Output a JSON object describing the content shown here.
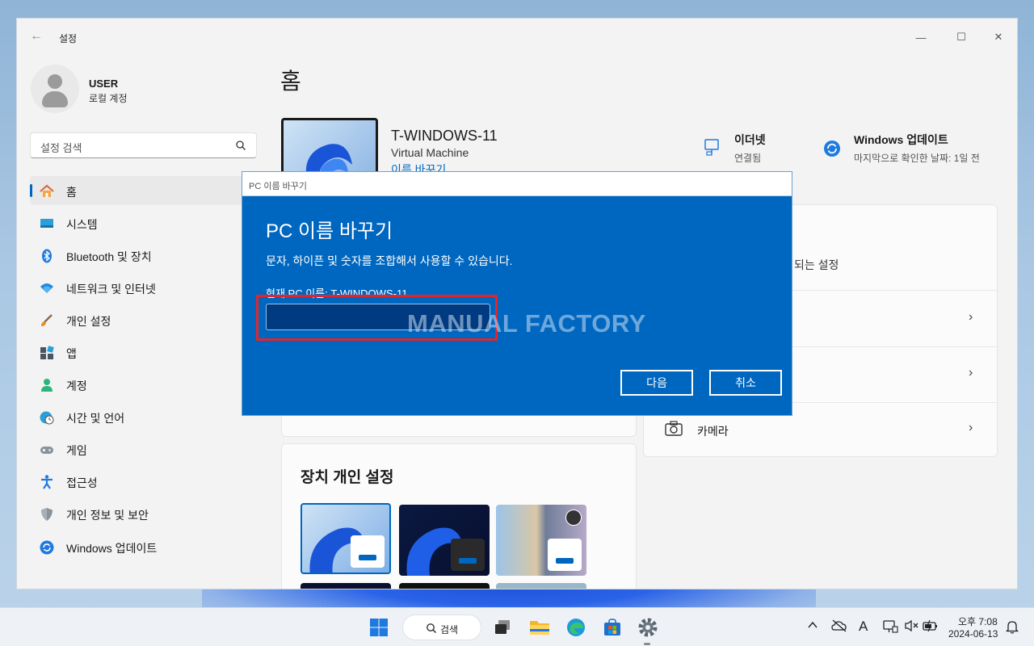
{
  "app": {
    "title": "설정"
  },
  "window_controls": {
    "minimize": "—",
    "maximize": "☐",
    "close": "✕"
  },
  "profile": {
    "name": "USER",
    "account_type": "로컬 계정"
  },
  "search": {
    "placeholder": "설정 검색"
  },
  "nav": [
    {
      "label": "홈",
      "icon": "home-icon",
      "active": true
    },
    {
      "label": "시스템",
      "icon": "system-icon"
    },
    {
      "label": "Bluetooth 및 장치",
      "icon": "bluetooth-icon"
    },
    {
      "label": "네트워크 및 인터넷",
      "icon": "wifi-icon"
    },
    {
      "label": "개인 설정",
      "icon": "brush-icon"
    },
    {
      "label": "앱",
      "icon": "apps-icon"
    },
    {
      "label": "계정",
      "icon": "account-icon"
    },
    {
      "label": "시간 및 언어",
      "icon": "globe-clock-icon"
    },
    {
      "label": "게임",
      "icon": "gamepad-icon"
    },
    {
      "label": "접근성",
      "icon": "accessibility-icon"
    },
    {
      "label": "개인 정보 및 보안",
      "icon": "shield-icon"
    },
    {
      "label": "Windows 업데이트",
      "icon": "update-icon"
    }
  ],
  "main": {
    "title": "홈",
    "device": {
      "name": "T-WINDOWS-11",
      "type": "Virtual Machine",
      "rename_link": "이름 바꾸기"
    },
    "status": {
      "network": {
        "title": "이더넷",
        "sub": "연결됨"
      },
      "update": {
        "title": "Windows 업데이트",
        "sub": "마지막으로 확인한 날짜: 1일 전"
      }
    },
    "right_card": {
      "partial_text": "되는 설정",
      "camera_label": "카메라"
    },
    "personalize": {
      "title": "장치 개인 설정"
    }
  },
  "dialog": {
    "window_title": "PC 이름 바꾸기",
    "heading": "PC 이름 바꾸기",
    "description": "문자, 하이픈 및 숫자를 조합해서 사용할 수 있습니다.",
    "current_name": "현재 PC 이름: T-WINDOWS-11",
    "input_value": "",
    "watermark": "MANUAL FACTORY",
    "next_label": "다음",
    "cancel_label": "취소"
  },
  "taskbar": {
    "search_label": "검색",
    "tray_font_indicator": "A",
    "clock_time": "오후 7:08",
    "clock_date": "2024-06-13"
  },
  "colors": {
    "accent": "#0067c0",
    "highlight_box": "#e0262b"
  }
}
